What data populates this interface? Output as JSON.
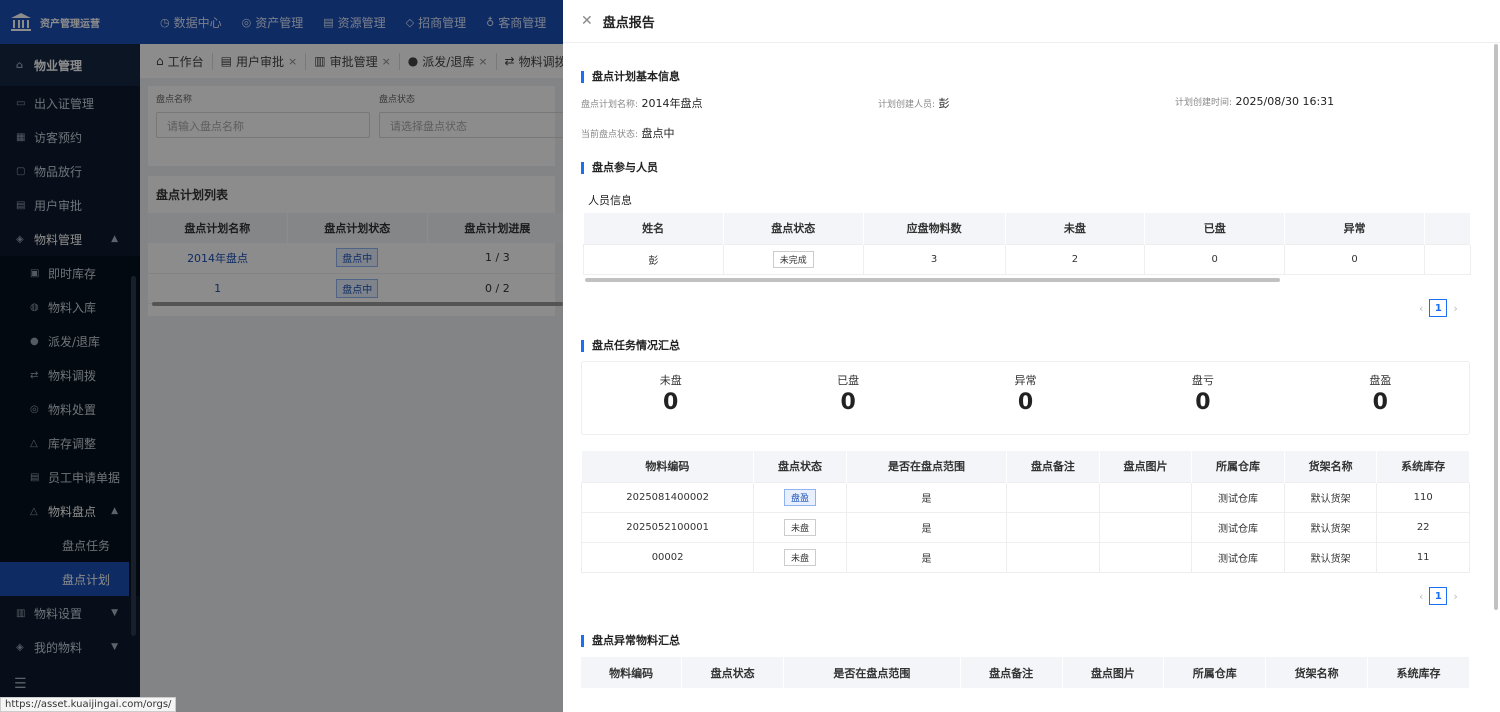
{
  "app": {
    "title": "资产管理运营"
  },
  "topnav": [
    {
      "icon": "◷",
      "label": "数据中心"
    },
    {
      "icon": "◎",
      "label": "资产管理"
    },
    {
      "icon": "▤",
      "label": "资源管理"
    },
    {
      "icon": "◇",
      "label": "招商管理"
    },
    {
      "icon": "♁",
      "label": "客商管理"
    }
  ],
  "sidebar": {
    "top": "物业管理",
    "items": [
      "出入证管理",
      "访客预约",
      "物品放行",
      "用户审批"
    ],
    "material": "物料管理",
    "material_sub": [
      "即时库存",
      "物料入库",
      "派发/退库",
      "物料调拨",
      "物料处置",
      "库存调整",
      "员工申请单据"
    ],
    "inventory": "物料盘点",
    "inventory_sub": [
      "盘点任务",
      "盘点计划"
    ],
    "settings": "物料设置",
    "mine": "我的物料"
  },
  "tabs": [
    "工作台",
    "用户审批",
    "审批管理",
    "派发/退库",
    "物料调拨"
  ],
  "filter": {
    "name_label": "盘点名称",
    "name_placeholder": "请输入盘点名称",
    "status_label": "盘点状态",
    "status_placeholder": "请选择盘点状态"
  },
  "plan_list": {
    "title": "盘点计划列表",
    "columns": [
      "盘点计划名称",
      "盘点计划状态",
      "盘点计划进展"
    ],
    "rows": [
      {
        "name": "2014年盘点",
        "status": "盘点中",
        "progress": "1 / 3"
      },
      {
        "name": "1",
        "status": "盘点中",
        "progress": "0 / 2"
      }
    ]
  },
  "drawer": {
    "title": "盘点报告",
    "basic_title": "盘点计划基本信息",
    "plan_name_k": "盘点计划名称:",
    "plan_name_v": "2014年盘点",
    "creator_k": "计划创建人员:",
    "creator_v": "彭",
    "created_k": "计划创建时间:",
    "created_v": "2025/08/30 16:31",
    "state_k": "当前盘点状态:",
    "state_v": "盘点中",
    "participants_title": "盘点参与人员",
    "people_info": "人员信息",
    "people_columns": [
      "姓名",
      "盘点状态",
      "应盘物料数",
      "未盘",
      "已盘",
      "异常"
    ],
    "people_rows": [
      [
        "彭",
        "未完成",
        "3",
        "2",
        "0",
        "0"
      ]
    ],
    "page": "1",
    "summary_title": "盘点任务情况汇总",
    "summary": [
      {
        "label": "未盘",
        "value": "0"
      },
      {
        "label": "已盘",
        "value": "0"
      },
      {
        "label": "异常",
        "value": "0"
      },
      {
        "label": "盘亏",
        "value": "0"
      },
      {
        "label": "盘盈",
        "value": "0"
      }
    ],
    "material_columns": [
      "物料编码",
      "盘点状态",
      "是否在盘点范围",
      "盘点备注",
      "盘点图片",
      "所属仓库",
      "货架名称",
      "系统库存"
    ],
    "material_rows": [
      [
        "2025081400002",
        "盘盈",
        "是",
        "",
        "",
        "测试仓库",
        "默认货架",
        "110"
      ],
      [
        "2025052100001",
        "未盘",
        "是",
        "",
        "",
        "测试仓库",
        "默认货架",
        "22"
      ],
      [
        "00002",
        "未盘",
        "是",
        "",
        "",
        "测试仓库",
        "默认货架",
        "11"
      ]
    ],
    "abnormal_title": "盘点异常物料汇总"
  },
  "status_url": "https://asset.kuaijingai.com/orgs/",
  "colors": {
    "brand": "#1a4fb5",
    "sidebar": "#0d1b2e",
    "accent": "#1a6ff5"
  }
}
